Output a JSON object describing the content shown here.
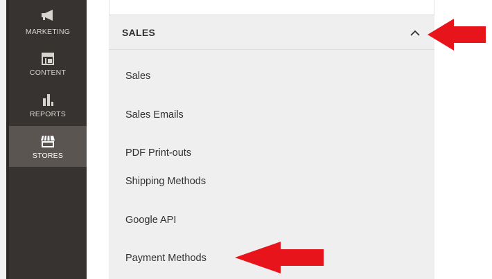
{
  "sidebar": {
    "items": [
      {
        "label": "MARKETING",
        "icon": "megaphone-icon"
      },
      {
        "label": "CONTENT",
        "icon": "layout-icon"
      },
      {
        "label": "REPORTS",
        "icon": "bar-chart-icon"
      },
      {
        "label": "STORES",
        "icon": "store-icon",
        "active": true
      }
    ]
  },
  "section": {
    "title": "SALES",
    "state": "expanded",
    "items": [
      "Sales",
      "Sales Emails",
      "PDF Print-outs",
      "Shipping Methods",
      "Google API",
      "Payment Methods"
    ]
  },
  "colors": {
    "sidebar_bg": "#373330",
    "sidebar_active": "#5b5551",
    "panel_bg": "#efefef",
    "arrow_red": "#e8141c"
  }
}
